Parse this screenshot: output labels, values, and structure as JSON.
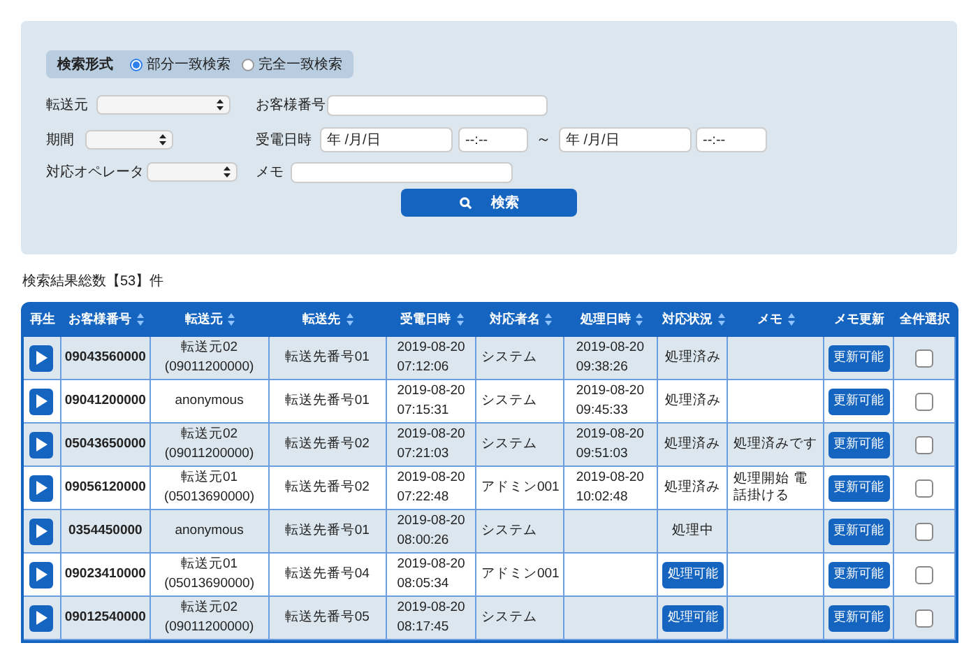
{
  "search_panel": {
    "mode_label": "検索形式",
    "modes": [
      {
        "label": "部分一致検索",
        "selected": true
      },
      {
        "label": "完全一致検索",
        "selected": false
      }
    ],
    "fields": {
      "source": {
        "label": "転送元"
      },
      "customer_number": {
        "label": "お客様番号"
      },
      "period": {
        "label": "期間"
      },
      "received": {
        "label": "受電日時",
        "from_date": "年 /月/日",
        "from_time": "--:--",
        "separator": "～",
        "to_date": "年 /月/日",
        "to_time": "--:--"
      },
      "operator": {
        "label": "対応オペレータ"
      },
      "memo": {
        "label": "メモ"
      }
    },
    "search_button": "検索"
  },
  "result_count": "検索結果総数【53】件",
  "table": {
    "columns": [
      {
        "label": "再生",
        "sortable": false
      },
      {
        "label": "お客様番号",
        "sortable": true
      },
      {
        "label": "転送元",
        "sortable": true
      },
      {
        "label": "転送先",
        "sortable": true
      },
      {
        "label": "受電日時",
        "sortable": true
      },
      {
        "label": "対応者名",
        "sortable": true
      },
      {
        "label": "処理日時",
        "sortable": true
      },
      {
        "label": "対応状況",
        "sortable": true
      },
      {
        "label": "メモ",
        "sortable": true
      },
      {
        "label": "メモ更新",
        "sortable": false
      },
      {
        "label": "全件選択",
        "sortable": false
      }
    ],
    "rows": [
      {
        "customer": "09043560000",
        "source": [
          "転送元02",
          "(09011200000)"
        ],
        "destination": "転送先番号01",
        "received": [
          "2019-08-20",
          "07:12:06"
        ],
        "handler": "システム",
        "processed": [
          "2019-08-20",
          "09:38:26"
        ],
        "status": {
          "kind": "text",
          "label": "処理済み"
        },
        "memo": "",
        "update": "更新可能",
        "checked": false
      },
      {
        "customer": "09041200000",
        "source": [
          "anonymous"
        ],
        "destination": "転送先番号01",
        "received": [
          "2019-08-20",
          "07:15:31"
        ],
        "handler": "システム",
        "processed": [
          "2019-08-20",
          "09:45:33"
        ],
        "status": {
          "kind": "text",
          "label": "処理済み"
        },
        "memo": "",
        "update": "更新可能",
        "checked": false
      },
      {
        "customer": "05043650000",
        "source": [
          "転送元02",
          "(09011200000)"
        ],
        "destination": "転送先番号02",
        "received": [
          "2019-08-20",
          "07:21:03"
        ],
        "handler": "システム",
        "processed": [
          "2019-08-20",
          "09:51:03"
        ],
        "status": {
          "kind": "text",
          "label": "処理済み"
        },
        "memo": "処理済みです",
        "update": "更新可能",
        "checked": false
      },
      {
        "customer": "09056120000",
        "source": [
          "転送元01",
          "(05013690000)"
        ],
        "destination": "転送先番号02",
        "received": [
          "2019-08-20",
          "07:22:48"
        ],
        "handler": "アドミン001",
        "processed": [
          "2019-08-20",
          "10:02:48"
        ],
        "status": {
          "kind": "text",
          "label": "処理済み"
        },
        "memo": "処理開始 電話掛ける",
        "update": "更新可能",
        "checked": false
      },
      {
        "customer": "0354450000",
        "source": [
          "anonymous"
        ],
        "destination": "転送先番号01",
        "received": [
          "2019-08-20",
          "08:00:26"
        ],
        "handler": "システム",
        "processed": [],
        "status": {
          "kind": "text",
          "label": "処理中"
        },
        "memo": "",
        "update": "更新可能",
        "checked": false
      },
      {
        "customer": "09023410000",
        "source": [
          "転送元01",
          "(05013690000)"
        ],
        "destination": "転送先番号04",
        "received": [
          "2019-08-20",
          "08:05:34"
        ],
        "handler": "アドミン001",
        "processed": [],
        "status": {
          "kind": "button",
          "label": "処理可能"
        },
        "memo": "",
        "update": "更新可能",
        "checked": false
      },
      {
        "customer": "09012540000",
        "source": [
          "転送元02",
          "(09011200000)"
        ],
        "destination": "転送先番号05",
        "received": [
          "2019-08-20",
          "08:17:45"
        ],
        "handler": "システム",
        "processed": [],
        "status": {
          "kind": "button",
          "label": "処理可能"
        },
        "memo": "",
        "update": "更新可能",
        "checked": false
      }
    ]
  }
}
